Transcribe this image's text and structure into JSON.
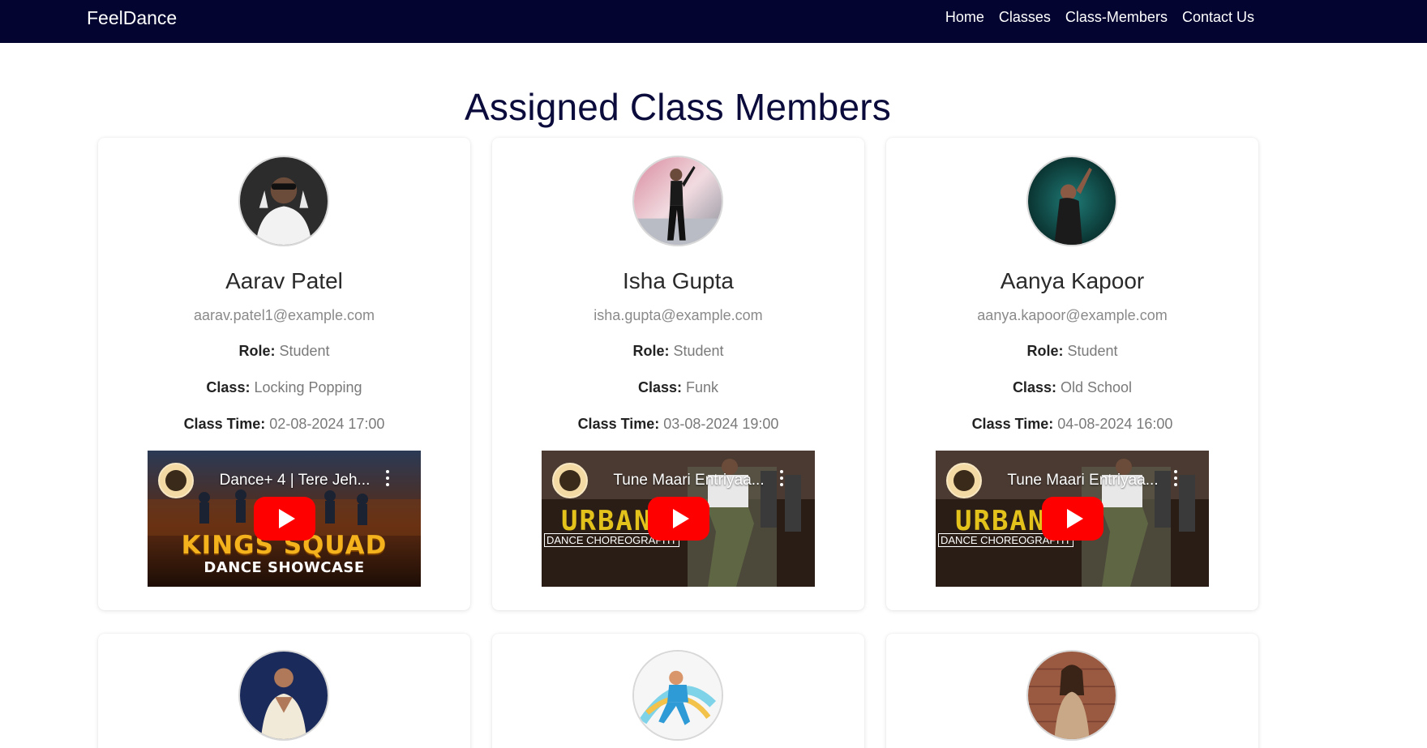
{
  "nav": {
    "brand": "FeelDance",
    "links": [
      "Home",
      "Classes",
      "Class-Members",
      "Contact Us"
    ]
  },
  "page": {
    "title": "Assigned Class Members"
  },
  "labels": {
    "role": "Role:",
    "class": "Class:",
    "class_time": "Class Time:"
  },
  "members": [
    {
      "name": "Aarav Patel",
      "email": "aarav.patel1@example.com",
      "role": "Student",
      "class": "Locking Popping",
      "class_time": "02-08-2024 17:00",
      "video": {
        "title": "Dance+ 4 | Tere Jeh...",
        "overlay_title": "KINGS SQUAD",
        "overlay_sub": "DANCE SHOWCASE"
      }
    },
    {
      "name": "Isha Gupta",
      "email": "isha.gupta@example.com",
      "role": "Student",
      "class": "Funk",
      "class_time": "03-08-2024 19:00",
      "video": {
        "title": "Tune Maari Entriyaa...",
        "overlay_title": "URBAN",
        "overlay_sub": "DANCE CHOREOGRAPHY"
      }
    },
    {
      "name": "Aanya Kapoor",
      "email": "aanya.kapoor@example.com",
      "role": "Student",
      "class": "Old School",
      "class_time": "04-08-2024 16:00",
      "video": {
        "title": "Tune Maari Entriyaa...",
        "overlay_title": "URBAN",
        "overlay_sub": "DANCE CHOREOGRAPHY"
      }
    }
  ],
  "colors": {
    "navbar_bg": "#030530",
    "title_color": "#0b0c3c",
    "play_red": "#ff0000"
  }
}
